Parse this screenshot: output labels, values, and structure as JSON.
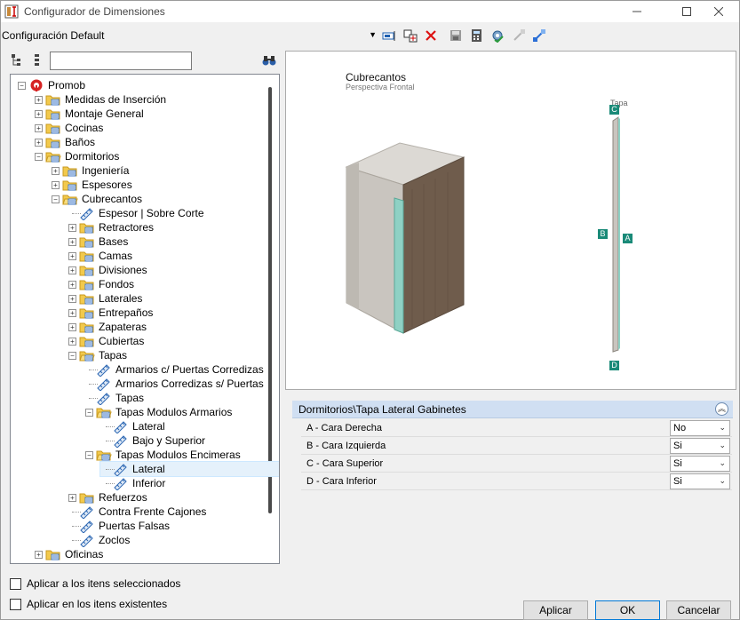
{
  "window": {
    "title": "Configurador de Dimensiones"
  },
  "toolbar": {
    "config_value": "Configuración Default"
  },
  "search": {
    "value": "",
    "placeholder": ""
  },
  "tree": [
    {
      "label": "Promob",
      "level": 0,
      "exp": "minus",
      "icon": "promob-logo-icon",
      "row": 0
    },
    {
      "label": "Medidas de Inserción",
      "level": 1,
      "exp": "plus",
      "icon": "folder-icon",
      "row": 1
    },
    {
      "label": "Montaje General",
      "level": 1,
      "exp": "plus",
      "icon": "folder-icon",
      "row": 2
    },
    {
      "label": "Cocinas",
      "level": 1,
      "exp": "plus",
      "icon": "folder-icon",
      "row": 3
    },
    {
      "label": "Baños",
      "level": 1,
      "exp": "plus",
      "icon": "folder-icon",
      "row": 4
    },
    {
      "label": "Dormitorios",
      "level": 1,
      "exp": "minus",
      "icon": "folder-open-icon",
      "row": 5
    },
    {
      "label": "Ingeniería",
      "level": 2,
      "exp": "plus",
      "icon": "folder-icon",
      "row": 6
    },
    {
      "label": "Espesores",
      "level": 2,
      "exp": "plus",
      "icon": "folder-icon",
      "row": 7
    },
    {
      "label": "Cubrecantos",
      "level": 2,
      "exp": "minus",
      "icon": "folder-open-icon",
      "row": 8
    },
    {
      "label": "Espesor | Sobre Corte",
      "level": 3,
      "exp": "none",
      "icon": "ruler-icon",
      "row": 9
    },
    {
      "label": "Retractores",
      "level": 3,
      "exp": "plus",
      "icon": "folder-icon",
      "row": 10
    },
    {
      "label": "Bases",
      "level": 3,
      "exp": "plus",
      "icon": "folder-icon",
      "row": 11
    },
    {
      "label": "Camas",
      "level": 3,
      "exp": "plus",
      "icon": "folder-icon",
      "row": 12
    },
    {
      "label": "Divisiones",
      "level": 3,
      "exp": "plus",
      "icon": "folder-icon",
      "row": 13
    },
    {
      "label": "Fondos",
      "level": 3,
      "exp": "plus",
      "icon": "folder-icon",
      "row": 14
    },
    {
      "label": "Laterales",
      "level": 3,
      "exp": "plus",
      "icon": "folder-icon",
      "row": 15
    },
    {
      "label": "Entrepaños",
      "level": 3,
      "exp": "plus",
      "icon": "folder-icon",
      "row": 16
    },
    {
      "label": "Zapateras",
      "level": 3,
      "exp": "plus",
      "icon": "folder-icon",
      "row": 17
    },
    {
      "label": "Cubiertas",
      "level": 3,
      "exp": "plus",
      "icon": "folder-icon",
      "row": 18
    },
    {
      "label": "Tapas",
      "level": 3,
      "exp": "minus",
      "icon": "folder-open-icon",
      "row": 19
    },
    {
      "label": "Armarios c/ Puertas Corredizas",
      "level": 4,
      "exp": "none",
      "icon": "ruler-icon",
      "row": 20
    },
    {
      "label": "Armarios Corredizas s/ Puertas",
      "level": 4,
      "exp": "none",
      "icon": "ruler-icon",
      "row": 21
    },
    {
      "label": "Tapas",
      "level": 4,
      "exp": "none",
      "icon": "ruler-icon",
      "row": 22
    },
    {
      "label": "Tapas Modulos Armarios",
      "level": 4,
      "exp": "minus",
      "icon": "folder-open-icon",
      "row": 23
    },
    {
      "label": "Lateral",
      "level": 5,
      "exp": "none",
      "icon": "ruler-icon",
      "row": 24
    },
    {
      "label": "Bajo y Superior",
      "level": 5,
      "exp": "none",
      "icon": "ruler-icon",
      "row": 25
    },
    {
      "label": "Tapas Modulos Encimeras",
      "level": 4,
      "exp": "minus",
      "icon": "folder-open-icon",
      "row": 26
    },
    {
      "label": "Lateral",
      "level": 5,
      "exp": "none",
      "icon": "ruler-icon",
      "row": 27,
      "selected": true
    },
    {
      "label": "Inferior",
      "level": 5,
      "exp": "none",
      "icon": "ruler-icon",
      "row": 28
    },
    {
      "label": "Refuerzos",
      "level": 3,
      "exp": "plus",
      "icon": "folder-icon",
      "row": 29
    },
    {
      "label": "Contra Frente Cajones",
      "level": 3,
      "exp": "none",
      "icon": "ruler-icon",
      "row": 30
    },
    {
      "label": "Puertas Falsas",
      "level": 3,
      "exp": "none",
      "icon": "ruler-icon",
      "row": 31
    },
    {
      "label": "Zoclos",
      "level": 3,
      "exp": "none",
      "icon": "ruler-icon",
      "row": 32
    },
    {
      "label": "Oficinas",
      "level": 1,
      "exp": "plus",
      "icon": "folder-icon",
      "row": 33
    }
  ],
  "checks": {
    "apply_selected": "Aplicar a los itens seleccionados",
    "apply_existing": "Aplicar en los itens existentes"
  },
  "preview": {
    "title": "Cubrecantos",
    "subtitle": "Perspectiva Frontal",
    "side_label": "Tapa",
    "markers": {
      "A": "A",
      "B": "B",
      "C": "C",
      "D": "D"
    }
  },
  "properties": {
    "header": "Dormitorios\\Tapa Lateral Gabinetes",
    "rows": [
      {
        "name": "A - Cara Derecha",
        "value": "No"
      },
      {
        "name": "B - Cara Izquierda",
        "value": "Si"
      },
      {
        "name": "C - Cara Superior",
        "value": "Si"
      },
      {
        "name": "D - Cara Inferior",
        "value": "Si"
      }
    ]
  },
  "buttons": {
    "apply": "Aplicar",
    "ok": "OK",
    "cancel": "Cancelar"
  },
  "colors": {
    "accent": "#0078d7",
    "edge_marker": "#1a8a78",
    "header_bg": "#d0dff2",
    "selected_bg": "#e5f1fb"
  }
}
